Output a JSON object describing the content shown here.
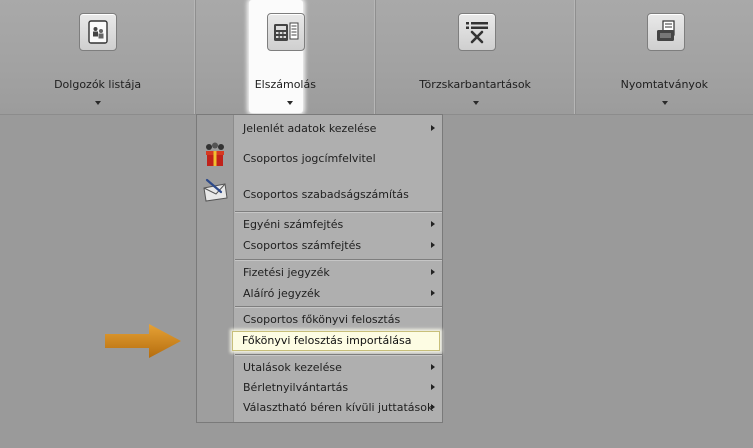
{
  "toolbar": {
    "items": [
      {
        "label": "Dolgozók listája",
        "icon": "employees-list-icon"
      },
      {
        "label": "Elszámolás",
        "icon": "calculator-document-icon",
        "active": true
      },
      {
        "label": "Törzskarbantartások",
        "icon": "list-tools-icon"
      },
      {
        "label": "Nyomtatványok",
        "icon": "print-forms-icon"
      }
    ]
  },
  "menu": {
    "items": [
      {
        "label": "Jelenlét adatok kezelése",
        "submenu": true
      },
      {
        "label": "Csoportos jogcímfelvitel",
        "icon": "gift-people-icon"
      },
      {
        "label": "Csoportos szabadságszámítás",
        "icon": "envelope-pen-icon"
      },
      {
        "label": "Egyéni számfejtés",
        "submenu": true
      },
      {
        "label": "Csoportos számfejtés",
        "submenu": true
      },
      {
        "label": "Fizetési jegyzék",
        "submenu": true
      },
      {
        "label": "Aláíró jegyzék",
        "submenu": true
      },
      {
        "label": "Csoportos főkönyvi felosztás"
      },
      {
        "label": "Főkönyvi felosztás importálása",
        "highlighted": true
      },
      {
        "label": "Utalások kezelése",
        "submenu": true
      },
      {
        "label": "Bérletnyilvántartás",
        "submenu": true
      },
      {
        "label": "Választható béren kívüli juttatások",
        "submenu": true
      }
    ]
  },
  "colors": {
    "background": "#9a9a9a",
    "highlight": "#fdfce3",
    "arrow": "#c97f16"
  }
}
